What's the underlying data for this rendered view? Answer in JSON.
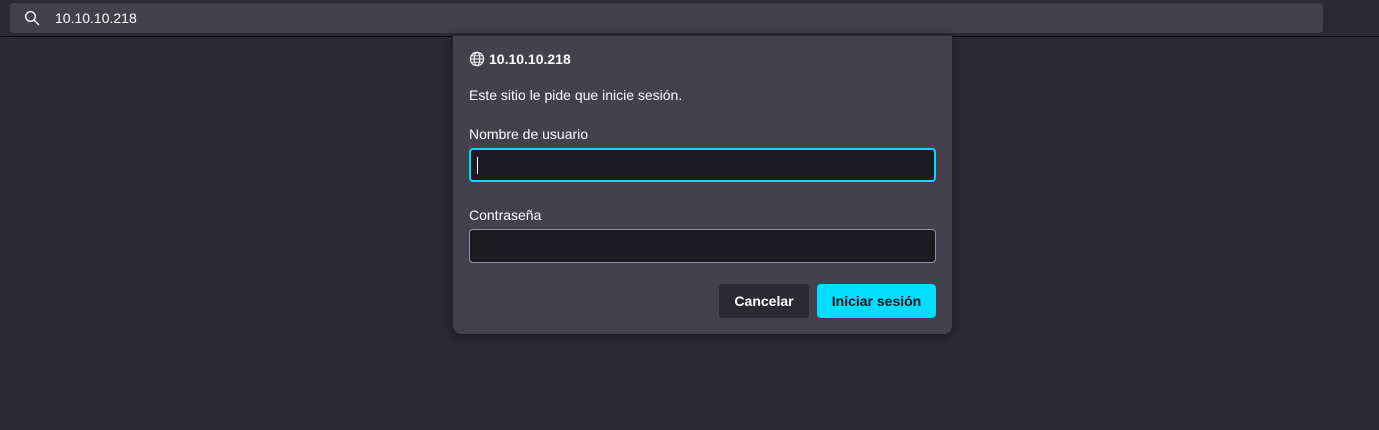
{
  "urlbar": {
    "url": "10.10.10.218",
    "icon": "search-icon"
  },
  "dialog": {
    "host": "10.10.10.218",
    "host_icon": "globe-icon",
    "message": "Este sitio le pide que inicie sesión.",
    "username_label": "Nombre de usuario",
    "username_value": "",
    "password_label": "Contraseña",
    "password_value": "",
    "cancel_label": "Cancelar",
    "login_label": "Iniciar sesión"
  },
  "colors": {
    "background": "#2b2a33",
    "dialog": "#42414d",
    "accent": "#00ddff",
    "field": "#1c1b22"
  }
}
